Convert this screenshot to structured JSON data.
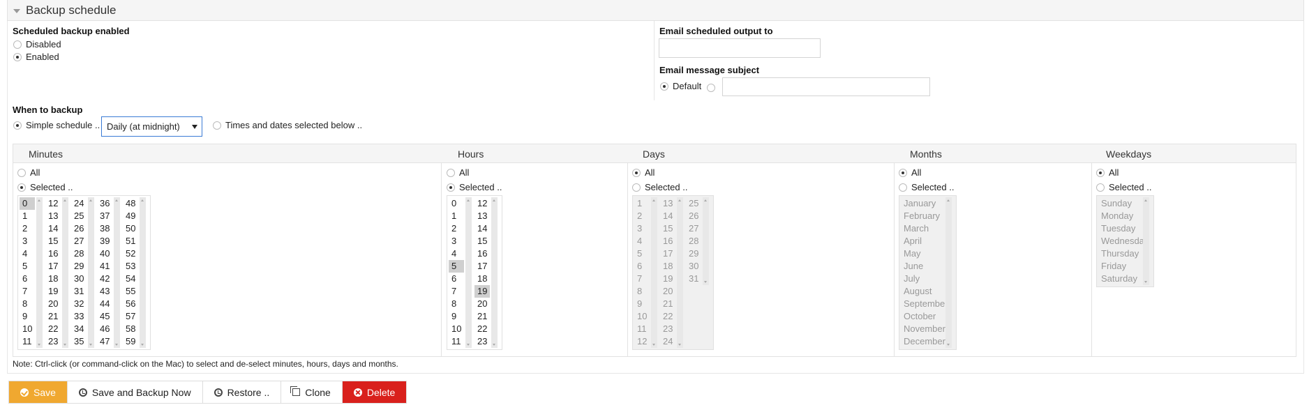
{
  "header": {
    "title": "Backup schedule"
  },
  "enabled_section": {
    "label": "Scheduled backup enabled",
    "options": [
      {
        "label": "Disabled",
        "selected": false
      },
      {
        "label": "Enabled",
        "selected": true
      }
    ]
  },
  "email": {
    "output_label": "Email scheduled output to",
    "output_value": "",
    "subject_label": "Email message subject",
    "default_label": "Default",
    "default_selected": true,
    "subject_value": ""
  },
  "when": {
    "label": "When to backup",
    "simple_label": "Simple schedule ..",
    "simple_selected": true,
    "simple_value": "Daily (at midnight)",
    "times_label": "Times and dates selected below ..",
    "times_selected": false
  },
  "columns": {
    "minutes": {
      "heading": "Minutes",
      "all_label": "All",
      "selected_label": "Selected ..",
      "mode": "selected"
    },
    "hours": {
      "heading": "Hours",
      "all_label": "All",
      "selected_label": "Selected ..",
      "mode": "selected"
    },
    "days": {
      "heading": "Days",
      "all_label": "All",
      "selected_label": "Selected ..",
      "mode": "all"
    },
    "months": {
      "heading": "Months",
      "all_label": "All",
      "selected_label": "Selected ..",
      "mode": "all"
    },
    "weekdays": {
      "heading": "Weekdays",
      "all_label": "All",
      "selected_label": "Selected ..",
      "mode": "all"
    }
  },
  "lists": {
    "minutes": [
      [
        "0",
        "1",
        "2",
        "3",
        "4",
        "5",
        "6",
        "7",
        "8",
        "9",
        "10",
        "11"
      ],
      [
        "12",
        "13",
        "14",
        "15",
        "16",
        "17",
        "18",
        "19",
        "20",
        "21",
        "22",
        "23"
      ],
      [
        "24",
        "25",
        "26",
        "27",
        "28",
        "29",
        "30",
        "31",
        "32",
        "33",
        "34",
        "35"
      ],
      [
        "36",
        "37",
        "38",
        "39",
        "40",
        "41",
        "42",
        "43",
        "44",
        "45",
        "46",
        "47"
      ],
      [
        "48",
        "49",
        "50",
        "51",
        "52",
        "53",
        "54",
        "55",
        "56",
        "57",
        "58",
        "59"
      ]
    ],
    "minutes_selected": [
      "0"
    ],
    "hours": [
      [
        "0",
        "1",
        "2",
        "3",
        "4",
        "5",
        "6",
        "7",
        "8",
        "9",
        "10",
        "11"
      ],
      [
        "12",
        "13",
        "14",
        "15",
        "16",
        "17",
        "18",
        "19",
        "20",
        "21",
        "22",
        "23"
      ]
    ],
    "hours_selected": [
      "5",
      "19"
    ],
    "days": [
      [
        "1",
        "2",
        "3",
        "4",
        "5",
        "6",
        "7",
        "8",
        "9",
        "10",
        "11",
        "12"
      ],
      [
        "13",
        "14",
        "15",
        "16",
        "17",
        "18",
        "19",
        "20",
        "21",
        "22",
        "23",
        "24"
      ],
      [
        "25",
        "26",
        "27",
        "28",
        "29",
        "30",
        "31"
      ]
    ],
    "months": [
      [
        "January",
        "February",
        "March",
        "April",
        "May",
        "June",
        "July",
        "August",
        "September",
        "October",
        "November",
        "December"
      ]
    ],
    "weekdays": [
      [
        "Sunday",
        "Monday",
        "Tuesday",
        "Wednesday",
        "Thursday",
        "Friday",
        "Saturday"
      ]
    ]
  },
  "note": "Note: Ctrl-click (or command-click on the Mac) to select and de-select minutes, hours, days and months.",
  "buttons": {
    "save": "Save",
    "save_backup": "Save and Backup Now",
    "restore": "Restore ..",
    "clone": "Clone",
    "delete": "Delete"
  },
  "colors": {
    "save": "#f0a830",
    "delete": "#d9201c",
    "focus": "#3a7bd5"
  }
}
